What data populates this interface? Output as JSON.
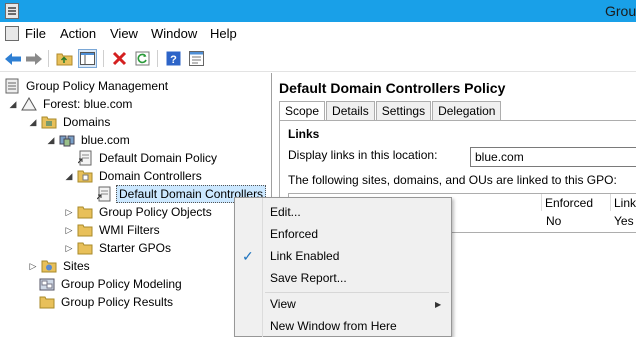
{
  "window": {
    "title": "Grou"
  },
  "menubar": {
    "items": [
      "File",
      "Action",
      "View",
      "Window",
      "Help"
    ]
  },
  "toolbar": {
    "buttons": [
      "back-icon",
      "forward-icon",
      "up-folder-icon",
      "show-hide-tree-icon",
      "delete-icon",
      "refresh-icon",
      "help-icon",
      "properties-icon"
    ]
  },
  "tree": {
    "root": "Group Policy Management",
    "forest": "Forest: blue.com",
    "domains": "Domains",
    "domain": "blue.com",
    "default_domain_policy": "Default Domain Policy",
    "domain_controllers": "Domain Controllers",
    "default_dc_policy": "Default Domain Controllers",
    "gpo": "Group Policy Objects",
    "wmi": "WMI Filters",
    "starter": "Starter GPOs",
    "sites": "Sites",
    "modeling": "Group Policy Modeling",
    "results": "Group Policy Results"
  },
  "details": {
    "title": "Default Domain Controllers Policy",
    "tabs": [
      "Scope",
      "Details",
      "Settings",
      "Delegation"
    ],
    "links_heading": "Links",
    "display_links_label": "Display links in this location:",
    "location_value": "blue.com",
    "linked_label": "The following sites, domains, and OUs are linked to this GPO:",
    "columns": [
      "Enforced",
      "Link"
    ],
    "row": {
      "enforced": "No",
      "link": "Yes"
    }
  },
  "context_menu": {
    "edit": "Edit...",
    "enforced": "Enforced",
    "link_enabled": "Link Enabled",
    "link_enabled_checked": true,
    "save_report": "Save Report...",
    "view": "View",
    "new_window": "New Window from Here"
  },
  "colors": {
    "titlebar": "#19a0e8",
    "selection": "#cce8ff",
    "check": "#1e73be"
  }
}
